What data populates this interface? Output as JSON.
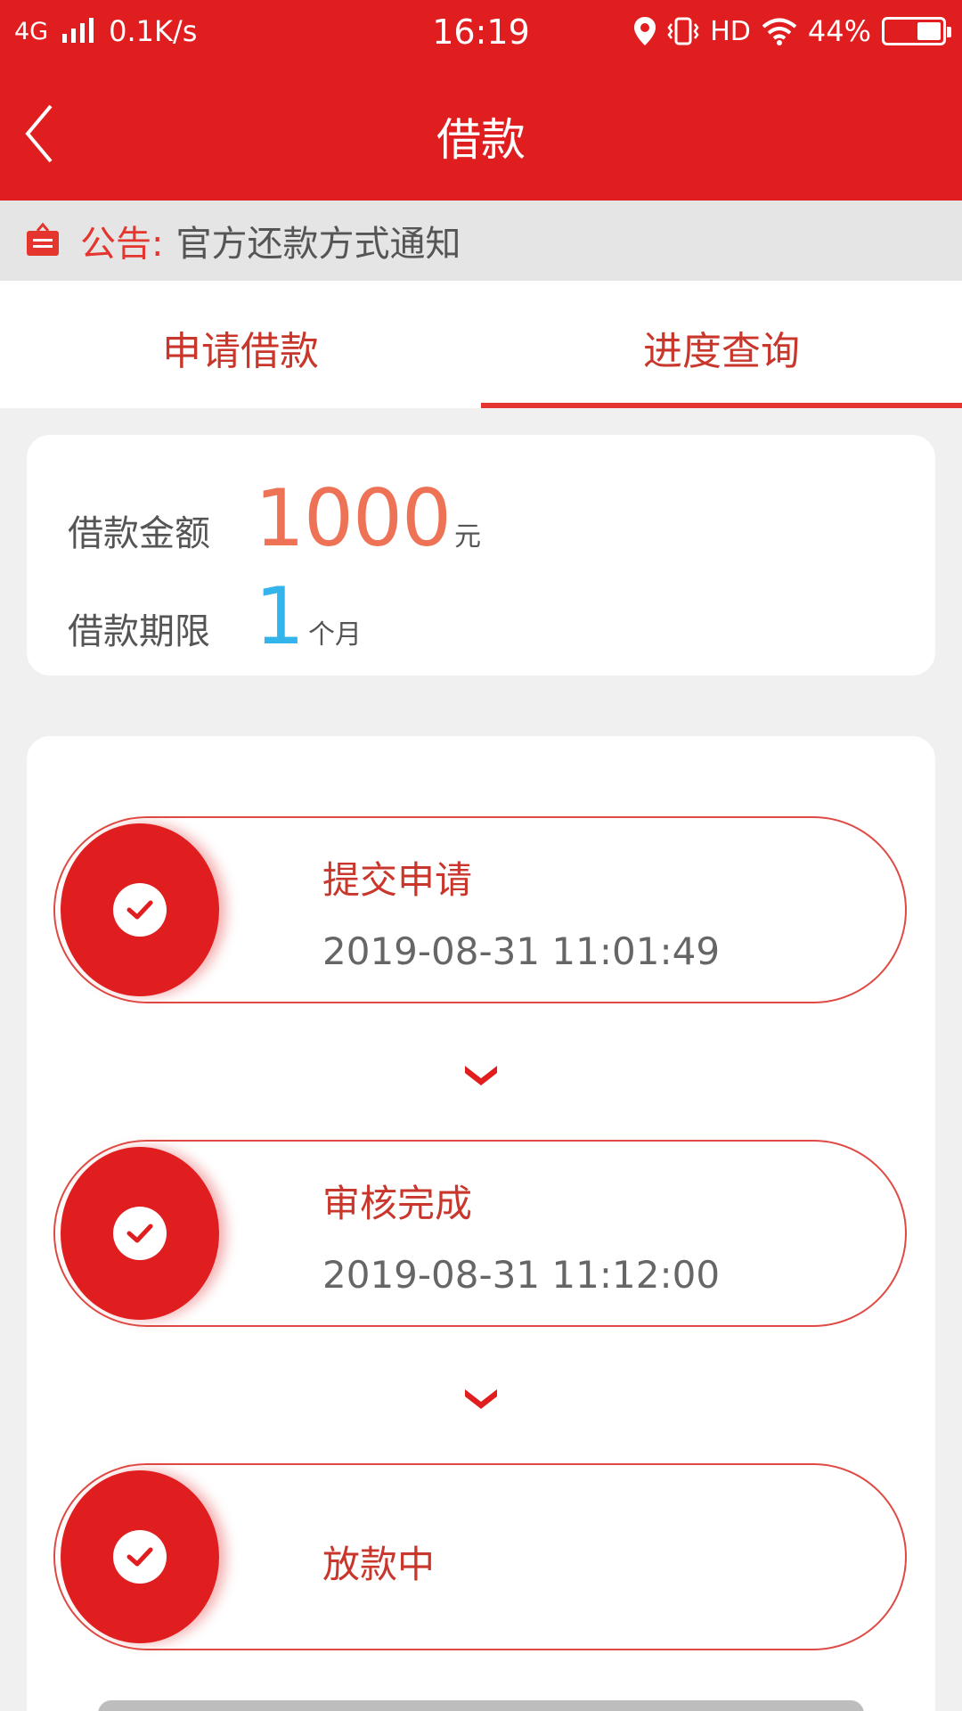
{
  "status_bar": {
    "network": "4G",
    "speed": "0.1K/s",
    "time": "16:19",
    "hd": "HD",
    "battery": "44%",
    "battery_level": 0.44
  },
  "nav": {
    "title": "借款",
    "back_icon": "chevron-left-icon"
  },
  "notice": {
    "icon": "notice-board-icon",
    "label": "公告:",
    "text": "官方还款方式通知"
  },
  "tabs": [
    {
      "label": "申请借款",
      "active": false
    },
    {
      "label": "进度查询",
      "active": true
    }
  ],
  "loan": {
    "amount_label": "借款金额",
    "amount": "1000",
    "amount_unit": "元",
    "term_label": "借款期限",
    "term": "1",
    "term_unit": "个月"
  },
  "steps": [
    {
      "title": "提交申请",
      "time": "2019-08-31 11:01:49",
      "done": true
    },
    {
      "title": "审核完成",
      "time": "2019-08-31 11:12:00",
      "done": true
    },
    {
      "title": "放款中",
      "time": "",
      "done": true
    }
  ],
  "colors": {
    "brand_red": "#e01e1f",
    "amount_orange": "#ee7356",
    "term_blue": "#33b4ea"
  }
}
